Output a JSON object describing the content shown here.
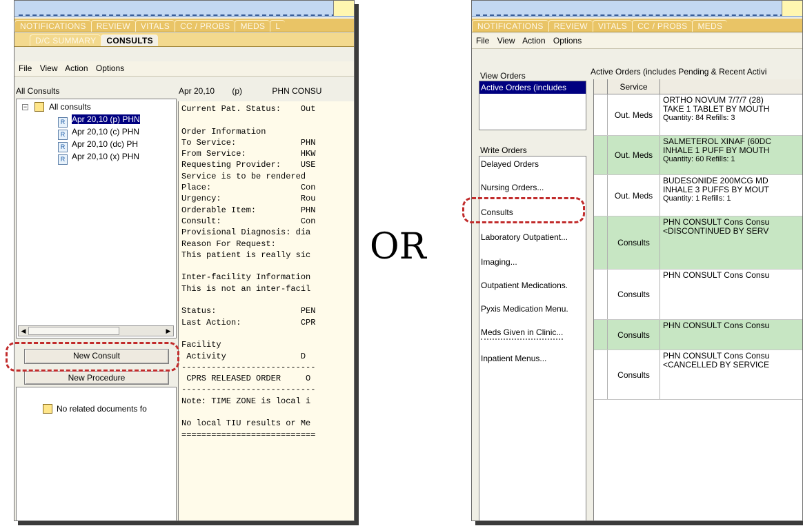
{
  "left": {
    "tabs_row1": [
      "NOTIFICATIONS",
      "REVIEW",
      "VITALS",
      "CC / PROBS",
      "MEDS",
      "L"
    ],
    "tabs_row2": [
      "D/C SUMMARY",
      "CONSULTS"
    ],
    "menu": [
      "File",
      "View",
      "Action",
      "Options"
    ],
    "tree_header": "All Consults",
    "tree_root": "All consults",
    "tree_items": [
      "Apr 20,10  (p)  PHN",
      "Apr 20,10  (c)  PHN",
      "Apr 20,10  (dc) PH",
      "Apr 20,10  (x)  PHN"
    ],
    "detail_header": {
      "date": "Apr 20,10",
      "status": "(p)",
      "title": "PHN CONSU"
    },
    "detail_lines": [
      "Current Pat. Status:    Out",
      "",
      "Order Information",
      "To Service:             PHN",
      "From Service:           HKW",
      "Requesting Provider:    USE",
      "Service is to be rendered",
      "Place:                  Con",
      "Urgency:                Rou",
      "Orderable Item:         PHN",
      "Consult:                Con",
      "Provisional Diagnosis: dia",
      "Reason For Request:",
      "This patient is really sic",
      "",
      "Inter-facility Information",
      "This is not an inter-facil",
      "",
      "Status:                 PEN",
      "Last Action:            CPR",
      "",
      "Facility",
      " Activity               D",
      "---------------------------",
      " CPRS RELEASED ORDER     O",
      "---------------------------",
      "Note: TIME ZONE is local i",
      "",
      "No local TIU results or Me",
      "==========================="
    ],
    "new_consult_label": "New Consult",
    "new_procedure_label": "New Procedure",
    "related_docs": "No related documents fo"
  },
  "or_label": "OR",
  "right": {
    "tabs_row1": [
      "NOTIFICATIONS",
      "REVIEW",
      "VITALS",
      "CC / PROBS",
      "MEDS"
    ],
    "menu": [
      "File",
      "View",
      "Action",
      "Options"
    ],
    "view_orders_label": "View Orders",
    "view_orders_selected": "Active Orders (includes",
    "write_orders_label": "Write Orders",
    "write_orders_items": [
      "Delayed Orders",
      "Nursing Orders...",
      "Consults",
      "Laboratory Outpatient...",
      "Imaging...",
      "Outpatient Medications.",
      "Pyxis Medication Menu.",
      "Meds Given in Clinic...",
      "Inpatient Menus..."
    ],
    "grid_title": "Active Orders (includes Pending & Recent Activi",
    "grid_col_service": "Service",
    "rows": [
      {
        "service": "Out. Meds",
        "l1": "ORTHO NOVUM 7/7/7 (28)",
        "l2": "TAKE 1 TABLET BY MOUTH",
        "l3": "Quantity: 84 Refills: 3",
        "green": false
      },
      {
        "service": "Out. Meds",
        "l1": "SALMETEROL XINAF (60DC",
        "l2": "INHALE 1 PUFF BY MOUTH",
        "l3": "Quantity: 60 Refills: 1",
        "green": true
      },
      {
        "service": "Out. Meds",
        "l1": "BUDESONIDE 200MCG MD",
        "l2": "INHALE 3 PUFFS BY MOUT",
        "l3": "Quantity: 1 Refills: 1",
        "green": false
      },
      {
        "service": "Consults",
        "l1": "PHN CONSULT Cons Consu",
        "l2": "<DISCONTINUED BY SERV",
        "l3": "",
        "green": true
      },
      {
        "service": "Consults",
        "l1": "PHN CONSULT Cons Consu",
        "l2": "",
        "l3": "",
        "green": false
      },
      {
        "service": "Consults",
        "l1": "PHN CONSULT Cons Consu",
        "l2": "",
        "l3": "",
        "green": true
      },
      {
        "service": "Consults",
        "l1": "PHN CONSULT Cons Consu",
        "l2": "<CANCELLED BY SERVICE",
        "l3": "",
        "green": false
      }
    ]
  }
}
